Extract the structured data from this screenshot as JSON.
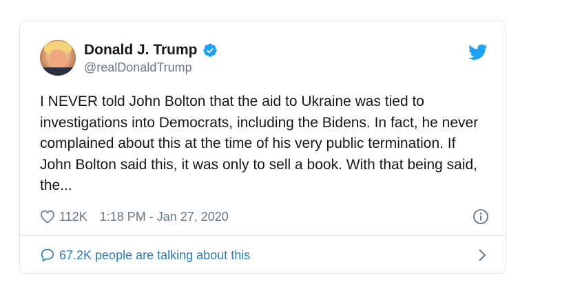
{
  "author": {
    "name": "Donald J. Trump",
    "handle": "@realDonaldTrump",
    "verified": true
  },
  "tweet": {
    "text": "I NEVER told John Bolton that the aid to Ukraine was tied to investigations into Democrats, including the Bidens. In fact, he never complained about this at the time of his very public termination. If John Bolton said this, it was only to sell a book. With that being said, the..."
  },
  "meta": {
    "likes": "112K",
    "timestamp": "1:18 PM - Jan 27, 2020"
  },
  "footer": {
    "talking": "67.2K people are talking about this"
  },
  "colors": {
    "verified": "#1da1f2",
    "twitter_bird": "#1da1f2",
    "link": "#2b7bb9",
    "muted": "#657786",
    "border": "#e1e8ed"
  },
  "icons": [
    "verified-badge-icon",
    "twitter-bird-icon",
    "heart-icon",
    "info-icon",
    "speech-bubble-icon",
    "chevron-right-icon"
  ]
}
